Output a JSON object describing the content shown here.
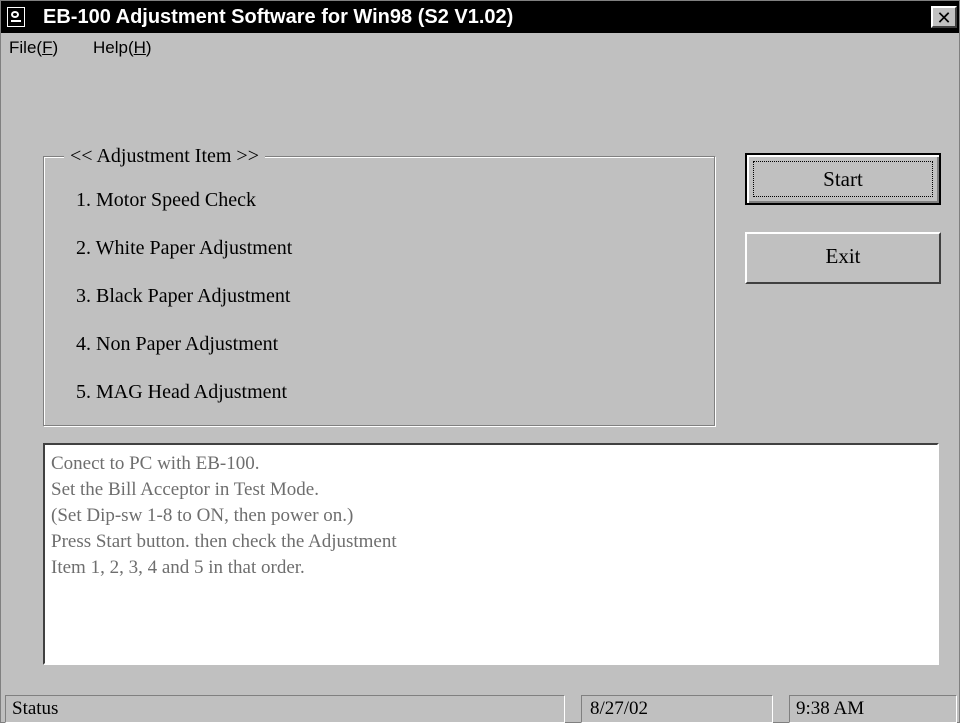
{
  "window": {
    "title": "EB-100 Adjustment Software for Win98 (S2 V1.02)",
    "close_label": "✕"
  },
  "menu": {
    "file": {
      "text": "File(",
      "accel": "F",
      "end": ")"
    },
    "help": {
      "text": "Help(",
      "accel": "H",
      "end": ")"
    }
  },
  "adjustment": {
    "title": "<< Adjustment Item >>",
    "items": [
      "1. Motor Speed Check",
      "2. White Paper Adjustment",
      "3. Black Paper Adjustment",
      "4. Non Paper Adjustment",
      "5. MAG Head Adjustment"
    ]
  },
  "buttons": {
    "start": "Start",
    "exit": "Exit"
  },
  "instructions": [
    "Conect to PC with EB-100.",
    "Set the Bill Acceptor in Test Mode.",
    "(Set Dip-sw 1-8 to ON, then power on.)",
    "Press Start button. then check the Adjustment",
    "Item 1, 2, 3, 4 and 5 in that order."
  ],
  "status": {
    "text": "Status",
    "date": "8/27/02",
    "time": "9:38 AM"
  },
  "colors": {
    "face": "#c0c0c0",
    "titlebar": "#000000",
    "instruction_text": "#6e6e6e"
  },
  "icons": {
    "app": "app-icon",
    "close": "close-icon"
  }
}
